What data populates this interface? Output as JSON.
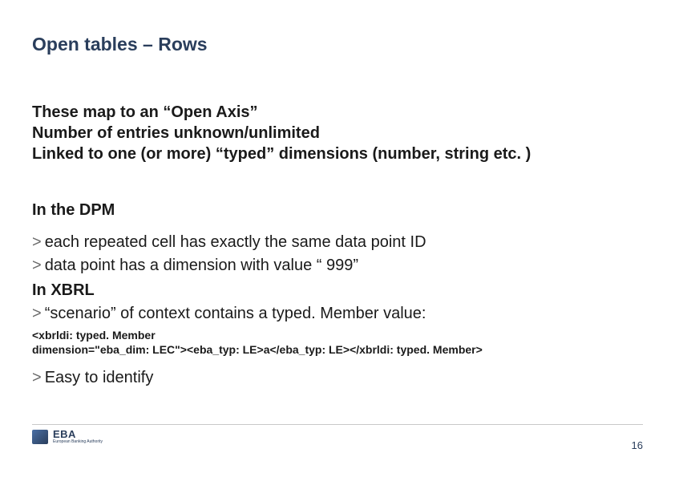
{
  "title": "Open tables – Rows",
  "intro": {
    "l1": "These map to an “Open Axis”",
    "l2": "Number of entries unknown/unlimited",
    "l3": "Linked to one (or more) “typed” dimensions (number, string etc. )"
  },
  "dpm": {
    "heading": "In the DPM",
    "b1": "each repeated cell has exactly the same data point ID",
    "b2": "data point has a dimension with value “ 999”"
  },
  "xbrl": {
    "heading": "In XBRL",
    "b1": "“scenario” of context contains a typed. Member value:",
    "code_l1": "<xbrldi: typed. Member",
    "code_l2": "dimension=\"eba_dim: LEC\"><eba_typ: LE>a</eba_typ: LE></xbrldi: typed. Member>",
    "b2": "Easy to identify"
  },
  "logo": {
    "eba": "EBA",
    "sub": "European\nBanking\nAuthority"
  },
  "page_number": "16",
  "gt": ">"
}
